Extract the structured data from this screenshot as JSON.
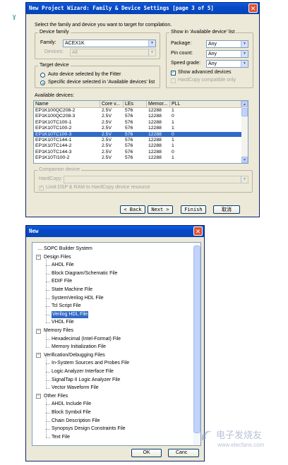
{
  "page_marker": "ɣ",
  "wizard": {
    "title": "New Project Wizard: Family & Device Settings [page 3 of 5]",
    "close": "✕",
    "instruction": "Select the family and device you want to target for compilation.",
    "device_family": {
      "legend": "Device family",
      "family_label": "Family:",
      "family_value": "ACEX1K",
      "devices_label": "Devices:",
      "devices_value": "All"
    },
    "target_device": {
      "legend": "Target device",
      "auto_label": "Auto device selected by the Fitter",
      "specific_label": "Specific device selected in 'Available devices' list",
      "selected": "specific"
    },
    "show_list": {
      "legend": "Show in 'Available device' list",
      "package_label": "Package:",
      "package_value": "Any",
      "pincount_label": "Pin count:",
      "pincount_value": "Any",
      "speed_label": "Speed grade:",
      "speed_value": "Any",
      "show_advanced_label": "Show advanced devices",
      "show_advanced_checked": true,
      "hardcopy_compat_label": "HardCopy compatible only",
      "hardcopy_compat_checked": false
    },
    "available_label": "Available devices:",
    "columns": [
      "Name",
      "Core v...",
      "LEs",
      "Memor...",
      "PLL"
    ],
    "devices": [
      [
        "EP1K100QC208-2",
        "2.5V",
        "576",
        "12288",
        "1"
      ],
      [
        "EP1K100QC208-3",
        "2.5V",
        "576",
        "12288",
        "0"
      ],
      [
        "EP1K10TC100-1",
        "2.5V",
        "576",
        "12288",
        "1"
      ],
      [
        "EP1K10TC100-2",
        "2.5V",
        "576",
        "12288",
        "1"
      ],
      [
        "EP1K10TC100-3",
        "2.5V",
        "576",
        "12288",
        "0"
      ],
      [
        "EP1K10TC144-1",
        "2.5V",
        "576",
        "12288",
        "1"
      ],
      [
        "EP1K10TC144-2",
        "2.5V",
        "576",
        "12288",
        "1"
      ],
      [
        "EP1K10TC144-3",
        "2.5V",
        "576",
        "12288",
        "0"
      ],
      [
        "EP1K10TI100-2",
        "2.5V",
        "576",
        "12288",
        "1"
      ]
    ],
    "selected_device_index": 4,
    "companion": {
      "legend": "Companion device",
      "hardcopy_label": "HardCopy:",
      "hardcopy_value": "",
      "limit_label": "Limit DSP & RAM to HardCopy device resource",
      "limit_checked": true
    },
    "buttons": {
      "back": "< Back",
      "next": "Next >",
      "finish": "Finish",
      "cancel": "取消"
    }
  },
  "new_dialog": {
    "title": "New",
    "close": "✕",
    "ok": "OK",
    "cancel": "Canc",
    "tree": [
      {
        "level": 0,
        "label": "SOPC Builder System",
        "expander": ""
      },
      {
        "level": 0,
        "label": "Design Files",
        "expander": "−"
      },
      {
        "level": 1,
        "label": "AHDL File"
      },
      {
        "level": 1,
        "label": "Block Diagram/Schematic File"
      },
      {
        "level": 1,
        "label": "EDIF File"
      },
      {
        "level": 1,
        "label": "State Machine File"
      },
      {
        "level": 1,
        "label": "SystemVerilog HDL File"
      },
      {
        "level": 1,
        "label": "Tcl Script File"
      },
      {
        "level": 1,
        "label": "Verilog HDL File",
        "selected": true
      },
      {
        "level": 1,
        "label": "VHDL File"
      },
      {
        "level": 0,
        "label": "Memory Files",
        "expander": "−"
      },
      {
        "level": 1,
        "label": "Hexadecimal (Intel-Format) File"
      },
      {
        "level": 1,
        "label": "Memory Initialization File"
      },
      {
        "level": 0,
        "label": "Verification/Debugging Files",
        "expander": "−"
      },
      {
        "level": 1,
        "label": "In-System Sources and Probes File"
      },
      {
        "level": 1,
        "label": "Logic Analyzer Interface File"
      },
      {
        "level": 1,
        "label": "SignalTap II Logic Analyzer File"
      },
      {
        "level": 1,
        "label": "Vector Waveform File"
      },
      {
        "level": 0,
        "label": "Other Files",
        "expander": "−"
      },
      {
        "level": 1,
        "label": "AHDL Include File"
      },
      {
        "level": 1,
        "label": "Block Symbol File"
      },
      {
        "level": 1,
        "label": "Chain Description File"
      },
      {
        "level": 1,
        "label": "Synopsys Design Constraints File"
      },
      {
        "level": 1,
        "label": "Text File"
      }
    ]
  },
  "watermark": {
    "cn": "电子发烧友",
    "url": "www.elecfans.com"
  }
}
